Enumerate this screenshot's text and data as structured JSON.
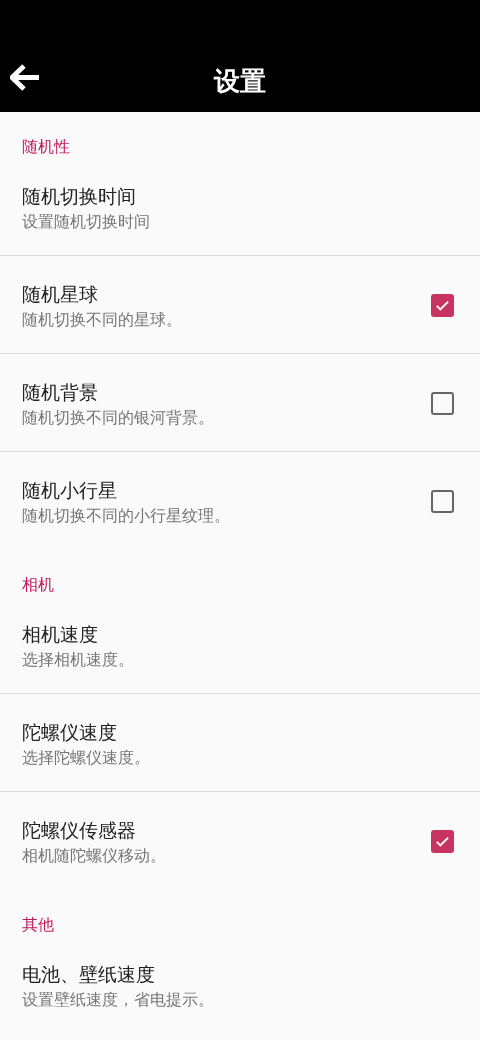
{
  "app_bar": {
    "title": "设置"
  },
  "sections": [
    {
      "header": "随机性",
      "items": [
        {
          "kind": "plain",
          "title": "随机切换时间",
          "summary": "设置随机切换时间"
        },
        {
          "kind": "checkbox",
          "title": "随机星球",
          "summary": "随机切换不同的星球。",
          "checked": true
        },
        {
          "kind": "checkbox",
          "title": "随机背景",
          "summary": "随机切换不同的银河背景。",
          "checked": false
        },
        {
          "kind": "checkbox",
          "title": "随机小行星",
          "summary": "随机切换不同的小行星纹理。",
          "checked": false
        }
      ]
    },
    {
      "header": "相机",
      "items": [
        {
          "kind": "plain",
          "title": "相机速度",
          "summary": "选择相机速度。"
        },
        {
          "kind": "plain",
          "title": "陀螺仪速度",
          "summary": "选择陀螺仪速度。"
        },
        {
          "kind": "checkbox",
          "title": "陀螺仪传感器",
          "summary": "相机随陀螺仪移动。",
          "checked": true
        }
      ]
    },
    {
      "header": "其他",
      "items": [
        {
          "kind": "plain",
          "title": "电池、壁纸速度",
          "summary": "设置壁纸速度，省电提示。"
        }
      ]
    }
  ]
}
